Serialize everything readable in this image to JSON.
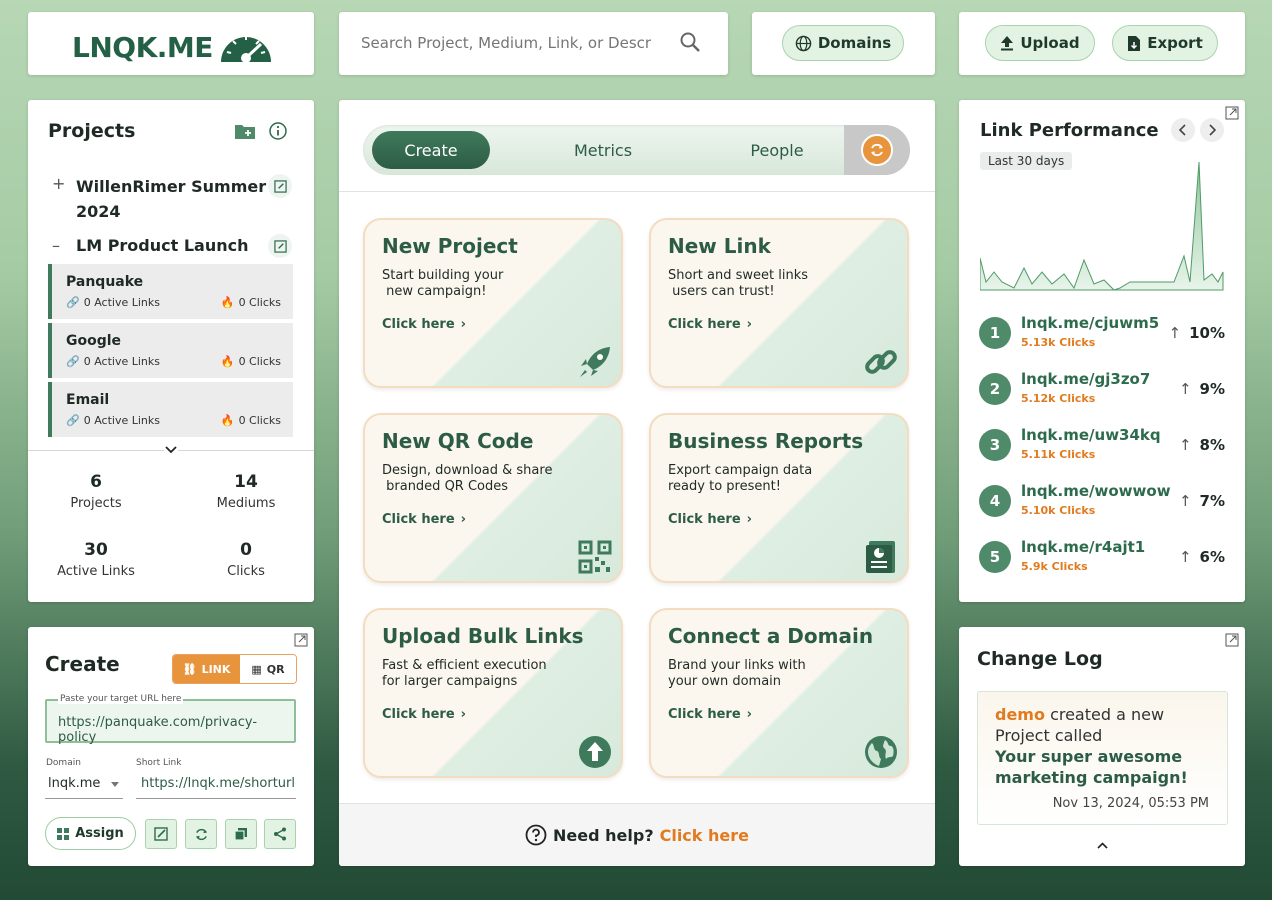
{
  "brand": {
    "logo_text": "LNQK.ME",
    "accent": "#2d6b4d",
    "orange": "#e07b1f"
  },
  "search": {
    "placeholder": "Search Project, Medium, Link, or Description",
    "icon": "search-icon"
  },
  "header": {
    "domains_label": "Domains",
    "upload_label": "Upload",
    "export_label": "Export"
  },
  "projects": {
    "title": "Projects",
    "items": [
      {
        "label": "WillenRimer Summer",
        "label2": "2024",
        "expander": "+"
      },
      {
        "label": "LM Product Launch",
        "expander": "–"
      }
    ],
    "mediums": [
      {
        "name": "Panquake",
        "active": "0 Active Links",
        "clicks": "0 Clicks"
      },
      {
        "name": "Google",
        "active": "0 Active Links",
        "clicks": "0 Clicks"
      },
      {
        "name": "Email",
        "active": "0 Active Links",
        "clicks": "0 Clicks"
      }
    ],
    "stats": [
      {
        "value": "6",
        "label": "Projects"
      },
      {
        "value": "14",
        "label": "Mediums"
      },
      {
        "value": "30",
        "label": "Active Links"
      },
      {
        "value": "0",
        "label": "Clicks"
      }
    ]
  },
  "main": {
    "tabs": [
      {
        "label": "Create"
      },
      {
        "label": "Metrics"
      },
      {
        "label": "People"
      }
    ],
    "cards": [
      {
        "title": "New Project",
        "desc": "Start building your\n new campaign!",
        "cta": "Click here",
        "icon": "rocket-icon"
      },
      {
        "title": "New Link",
        "desc": "Short and sweet links\n users can trust!",
        "cta": "Click here",
        "icon": "link-icon"
      },
      {
        "title": "New QR Code",
        "desc": "Design, download & share\n branded QR Codes",
        "cta": "Click here",
        "icon": "qr-code-icon"
      },
      {
        "title": "Business Reports",
        "desc": "Export campaign data\nready to present!",
        "cta": "Click here",
        "icon": "report-icon"
      },
      {
        "title": "Upload Bulk Links",
        "desc": "Fast & efficient execution\nfor larger campaigns",
        "cta": "Click here",
        "icon": "upload-icon"
      },
      {
        "title": "Connect a Domain",
        "desc": "Brand your links with\nyour own domain",
        "cta": "Click here",
        "icon": "globe-icon"
      }
    ],
    "help_text": "Need help?",
    "help_link": "Click here"
  },
  "create": {
    "title": "Create",
    "toggle_link": "LINK",
    "toggle_qr": "QR",
    "url_label": "Paste your target URL here",
    "url_value": "https://panquake.com/privacy-policy",
    "domain_label": "Domain",
    "domain_value": "lnqk.me",
    "short_label": "Short Link",
    "short_value": "https://lnqk.me/shorturl",
    "assign_label": "Assign"
  },
  "performance": {
    "title": "Link Performance",
    "range": "Last 30 days",
    "links": [
      {
        "rank": "1",
        "url": "lnqk.me/cjuwm5",
        "clicks": "5.13k Clicks",
        "pct": "10%"
      },
      {
        "rank": "2",
        "url": "lnqk.me/gj3zo7",
        "clicks": "5.12k Clicks",
        "pct": "9%"
      },
      {
        "rank": "3",
        "url": "lnqk.me/uw34kq",
        "clicks": "5.11k Clicks",
        "pct": "8%"
      },
      {
        "rank": "4",
        "url": "lnqk.me/wowwow",
        "clicks": "5.10k Clicks",
        "pct": "7%"
      },
      {
        "rank": "5",
        "url": "lnqk.me/r4ajt1",
        "clicks": "5.9k Clicks",
        "pct": "6%"
      }
    ]
  },
  "changelog": {
    "title": "Change Log",
    "user": "demo",
    "action": "created a new Project called",
    "project": "Your super awesome marketing campaign!",
    "time": "Nov 13, 2024, 05:53 PM"
  }
}
